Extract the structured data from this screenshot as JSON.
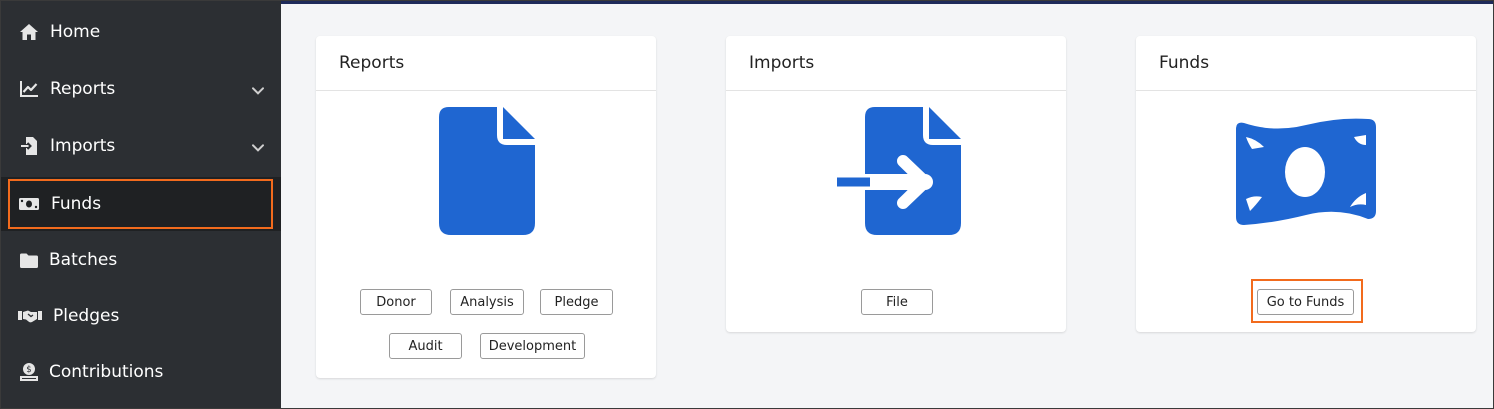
{
  "sidebar": {
    "items": [
      {
        "label": "Home",
        "icon": "home-icon"
      },
      {
        "label": "Reports",
        "icon": "chart-line-icon",
        "expandable": true
      },
      {
        "label": "Imports",
        "icon": "file-import-icon",
        "expandable": true
      },
      {
        "label": "Funds",
        "icon": "money-bill-icon",
        "active": true
      },
      {
        "label": "Batches",
        "icon": "folder-icon"
      },
      {
        "label": "Pledges",
        "icon": "handshake-icon"
      },
      {
        "label": "Contributions",
        "icon": "donation-hand-icon"
      }
    ]
  },
  "cards": {
    "reports": {
      "title": "Reports",
      "icon": "file-icon",
      "buttons": [
        "Donor",
        "Analysis",
        "Pledge",
        "Audit",
        "Development"
      ]
    },
    "imports": {
      "title": "Imports",
      "icon": "file-import-icon",
      "buttons": [
        "File"
      ]
    },
    "funds": {
      "title": "Funds",
      "icon": "money-bill-wave-icon",
      "buttons": [
        "Go to Funds"
      ]
    }
  },
  "colors": {
    "sidebar_bg": "#2c2f33",
    "icon_blue": "#1f66d1",
    "highlight": "#f26b1d"
  }
}
